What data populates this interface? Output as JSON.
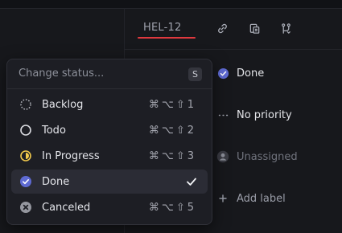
{
  "issue": {
    "id": "HEL-12"
  },
  "header_icons": [
    "link-icon",
    "copy-icon",
    "branch-icon"
  ],
  "menu": {
    "search_placeholder": "Change status...",
    "shortcut_key": "S",
    "items": [
      {
        "label": "Backlog",
        "icon": "backlog-icon",
        "shortcut": "⌘⌥⇧1",
        "active": false
      },
      {
        "label": "Todo",
        "icon": "todo-icon",
        "shortcut": "⌘⌥⇧2",
        "active": false
      },
      {
        "label": "In Progress",
        "icon": "in-progress-icon",
        "shortcut": "⌘⌥⇧3",
        "active": false
      },
      {
        "label": "Done",
        "icon": "done-icon",
        "shortcut": "",
        "active": true
      },
      {
        "label": "Canceled",
        "icon": "canceled-icon",
        "shortcut": "⌘⌥⇧5",
        "active": false
      }
    ]
  },
  "properties": {
    "status": "Done",
    "priority": "No priority",
    "assignee": "Unassigned",
    "add_label": "Add label"
  },
  "colors": {
    "accent_red": "#e0393e",
    "done_blue": "#5e6ad2",
    "in_progress_yellow": "#f2c94c",
    "canceled_gray": "#95979f"
  }
}
